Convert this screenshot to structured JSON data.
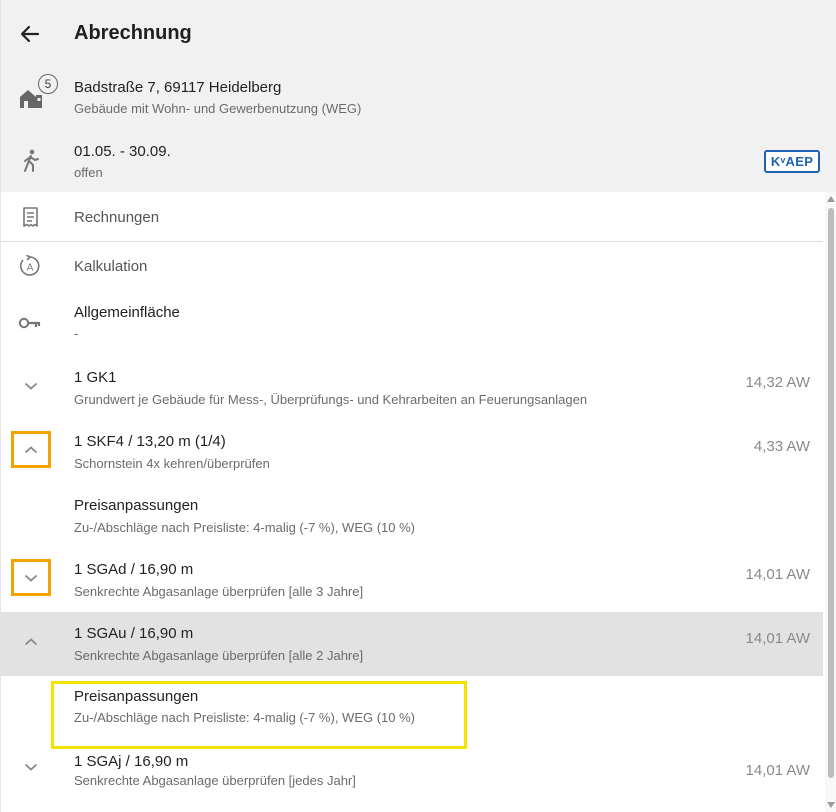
{
  "header": {
    "title": "Abrechnung",
    "back_icon": "arrow-left-icon"
  },
  "property": {
    "address": "Badstraße 7, 69117 Heidelberg",
    "type": "Gebäude mit Wohn- und Gewerbenutzung (WEG)",
    "count": "5"
  },
  "period": {
    "dates": "01.05. - 30.09.",
    "status": "offen",
    "badge": "KᵛAEP"
  },
  "menu": {
    "invoices": "Rechnungen",
    "calculation": "Kalkulation"
  },
  "general_area": {
    "title": "Allgemeinfläche",
    "subtitle": "-"
  },
  "positions": [
    {
      "title": "1 GK1",
      "subtitle": "Grundwert je Gebäude für Mess-, Überprüfungs- und Kehrarbeiten an Feuerungsanlagen",
      "value": "14,32 AW",
      "expanded": false
    },
    {
      "title": "1 SKF4 / 13,20 m (1/4)",
      "subtitle": "Schornstein 4x kehren/überprüfen",
      "value": "4,33 AW",
      "expanded": true
    },
    {
      "title": "1 SGAd / 16,90 m",
      "subtitle": "Senkrechte Abgasanlage überprüfen [alle 3 Jahre]",
      "value": "14,01 AW",
      "expanded": false
    },
    {
      "title": "1 SGAu / 16,90 m",
      "subtitle": "Senkrechte Abgasanlage überprüfen [alle 2 Jahre]",
      "value": "14,01 AW",
      "expanded": true
    },
    {
      "title": "1 SGAj / 16,90 m",
      "subtitle": "Senkrechte Abgasanlage überprüfen [jedes Jahr]",
      "value": "14,01 AW",
      "expanded": false
    }
  ],
  "adjustments": [
    {
      "title": "Preisanpassungen",
      "subtitle": "Zu-/Abschläge nach Preisliste: 4-malig (-7 %), WEG (10 %)"
    },
    {
      "title": "Preisanpassungen",
      "subtitle": "Zu-/Abschläge nach Preisliste: 4-malig (-7 %), WEG (10 %)"
    }
  ],
  "colors": {
    "header_bg": "#f1f1f1",
    "selected_row_bg": "#e2e2e2",
    "badge_blue": "#1e63b4",
    "highlight_orange": "#f4a300",
    "highlight_yellow": "#f4e200"
  }
}
